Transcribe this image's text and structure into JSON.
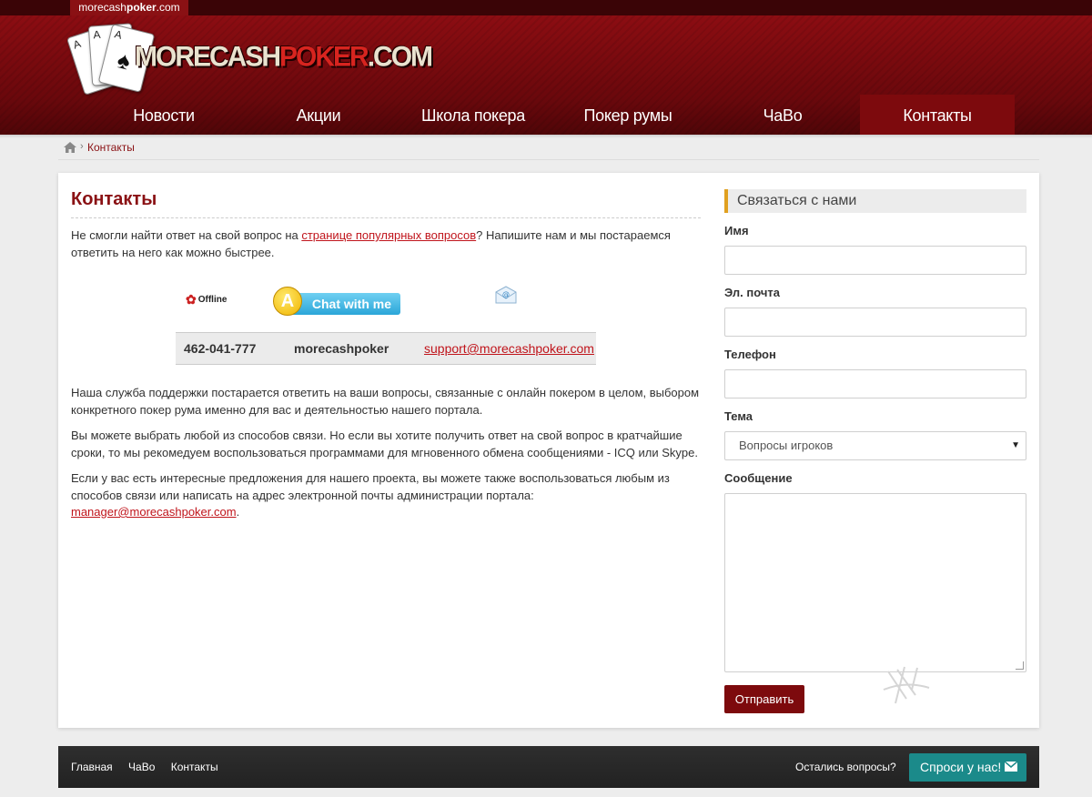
{
  "topbar": {
    "domain_prefix": "morecash",
    "domain_bold": "poker",
    "domain_suffix": ".com"
  },
  "logo": {
    "text_a": "MORECASH",
    "text_b": "POKER",
    "text_c": ".COM",
    "card_rank": "A"
  },
  "nav": {
    "items": [
      "Новости",
      "Акции",
      "Школа покера",
      "Покер румы",
      "ЧаВо",
      "Контакты"
    ],
    "active": "Контакты"
  },
  "breadcrumb": {
    "sep": "›",
    "current": "Контакты"
  },
  "main": {
    "title": "Контакты",
    "intro_before": "Не смогли найти ответ на свой вопрос на ",
    "intro_link": "странице популярных вопросов",
    "intro_after": "? Напишите нам и мы постараемся ответить на него как можно быстрее.",
    "offline_label": "Offline",
    "chat_label": "Chat with me",
    "chat_badge": "A",
    "contacts": {
      "icq": "462-041-777",
      "skype": "morecashpoker",
      "email": "support@morecashpoker.com"
    },
    "para1": "Наша служба поддержки постарается ответить на ваши вопросы, связанные с онлайн покером в целом, выбором конкретного покер рума именно для вас и деятельностью нашего портала.",
    "para2": "Вы можете выбрать любой из способов связи. Но если вы хотите получить ответ на свой вопрос в кратчайшие сроки, то мы рекомедуем воспользоваться программами для мгновенного обмена сообщениями - ICQ или Skype.",
    "para3_before": "Если у вас есть интересные предложения для нашего проекта, вы можете также воспользоваться любым из способов связи или написать на адрес электронной почты администрации портала: ",
    "para3_link": "manager@morecashpoker.com",
    "para3_after": "."
  },
  "form": {
    "title": "Связаться с нами",
    "name_label": "Имя",
    "email_label": "Эл. почта",
    "phone_label": "Телефон",
    "topic_label": "Тема",
    "topic_value": "Вопросы игроков",
    "message_label": "Сообщение",
    "submit_label": "Отправить"
  },
  "footer": {
    "links": [
      "Главная",
      "ЧаВо",
      "Контакты"
    ],
    "question": "Остались вопросы?",
    "ask_button": "Спроси у нас!"
  },
  "colors": {
    "brand_red": "#8a1114",
    "link_red": "#c0141b",
    "accent_teal": "#1b8a8a",
    "title_bar_accent": "#e0a020"
  }
}
